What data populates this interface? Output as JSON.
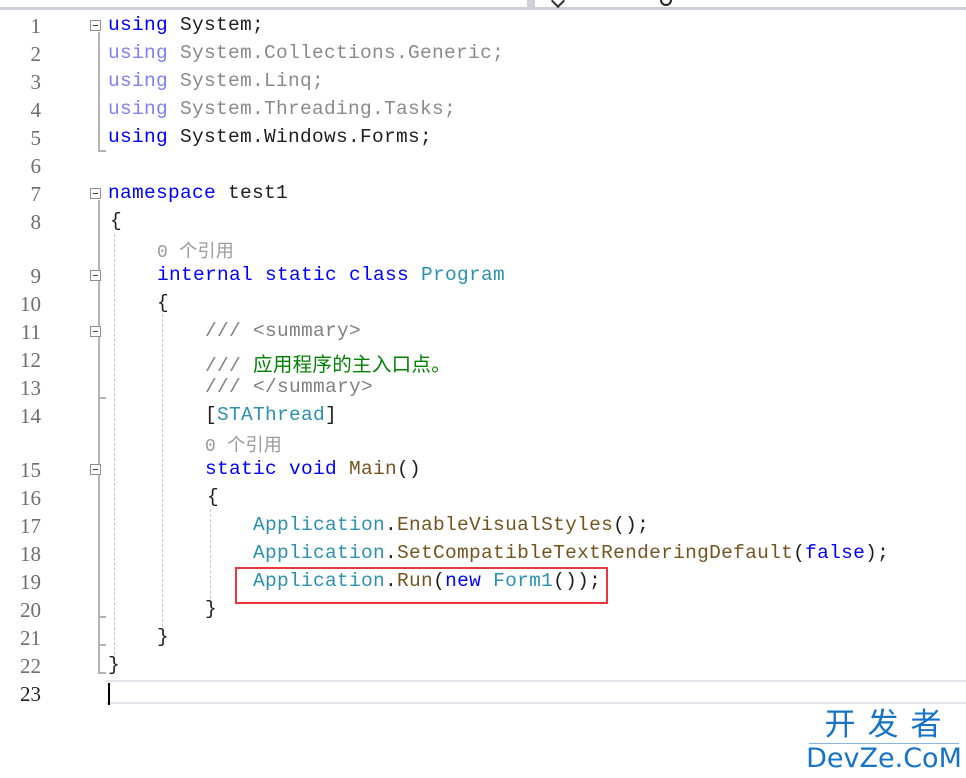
{
  "editor": {
    "language": "C#",
    "lines": [
      {
        "n": "1"
      },
      {
        "n": "2"
      },
      {
        "n": "3"
      },
      {
        "n": "4"
      },
      {
        "n": "5"
      },
      {
        "n": "6"
      },
      {
        "n": "7"
      },
      {
        "n": "8"
      },
      {
        "n": "9"
      },
      {
        "n": "10"
      },
      {
        "n": "11"
      },
      {
        "n": "12"
      },
      {
        "n": "13"
      },
      {
        "n": "14"
      },
      {
        "n": "15"
      },
      {
        "n": "16"
      },
      {
        "n": "17"
      },
      {
        "n": "18"
      },
      {
        "n": "19"
      },
      {
        "n": "20"
      },
      {
        "n": "21"
      },
      {
        "n": "22"
      },
      {
        "n": "23"
      }
    ],
    "tokens": {
      "using": "using",
      "l1_rest": " System;",
      "l2_rest": " System.Collections.Generic;",
      "l3_rest": " System.Linq;",
      "l4_rest": " System.Threading.Tasks;",
      "l5_rest": " System.Windows.Forms;",
      "namespace": "namespace",
      "ns_name": " test1",
      "open_brace": "{",
      "close_brace": "}",
      "internal_static_class": "internal static class",
      "program": " Program",
      "doc_prefix": "/// ",
      "summary_open": "<summary>",
      "summary_text": "应用程序的主入口点。",
      "summary_close": "</summary>",
      "bracket_open": "[",
      "stathread": "STAThread",
      "bracket_close": "]",
      "static_void": "static void",
      "main": " Main",
      "parens": "()",
      "application": "Application",
      "dot": ".",
      "enable_visual_styles": "EnableVisualStyles",
      "call_end": "();",
      "set_compat": "SetCompatibleTextRenderingDefault",
      "paren_open": "(",
      "false_kw": "false",
      "paren_close_semi": ");",
      "run": "Run",
      "new_kw": "new",
      "form1": " Form1",
      "run_end": "());"
    },
    "codelens": {
      "class_refs": "0 个引用",
      "main_refs": "0 个引用"
    },
    "current_line": "23",
    "highlighted_line": "19"
  },
  "colors": {
    "keyword": "#0000ff",
    "type": "#2b91af",
    "comment": "#008000",
    "method": "#74531f",
    "highlight_box": "#e8383d"
  },
  "watermark": {
    "cn": "开发者",
    "en": "DevZe.CoM"
  }
}
